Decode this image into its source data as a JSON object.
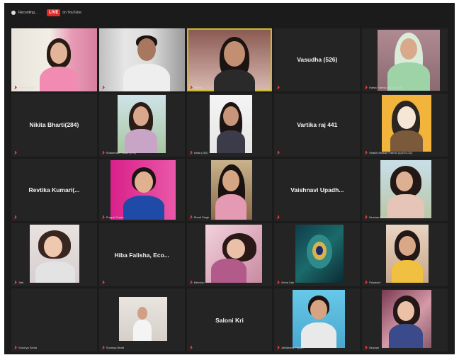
{
  "topbar": {
    "recording_label": "Recording...",
    "live_badge": "LIVE",
    "live_label": "on YouTube"
  },
  "tiles": [
    {
      "label": "Shifa Fatima"
    },
    {
      "label": "Amit Joshi"
    },
    {
      "label": "Nilima"
    },
    {
      "name": "Vasudha (526)",
      "label": ""
    },
    {
      "label": "Hafsa Fatima (Hy-Eco 32)"
    },
    {
      "name": "Nikita Bharti(284)",
      "label": ""
    },
    {
      "label": "Shambhavi Tiwari (174)"
    },
    {
      "label": "Ishita (262)"
    },
    {
      "name": "Vartika raj 441",
      "label": ""
    },
    {
      "label": "Shaikh Misbah Fatima (sy.Eco-32)"
    },
    {
      "name": "Revtika  Kumari(...",
      "label": ""
    },
    {
      "label": "Pragati Gupta"
    },
    {
      "label": "Shruti Singh"
    },
    {
      "name": "Vaishnavi  Upadh...",
      "label": ""
    },
    {
      "label": "Muskan Bharti"
    },
    {
      "label": "Jiah"
    },
    {
      "name": "Hiba Falisha, Eco...",
      "label": ""
    },
    {
      "label": "Mehvish"
    },
    {
      "label": "Neha Sah"
    },
    {
      "label": "Priyakshi"
    },
    {
      "label": "Soumya Sinha"
    },
    {
      "label": "Soumya Bhatt"
    },
    {
      "name": "Saloni Kri",
      "label": ""
    },
    {
      "label": "Abhilasha Priyam"
    },
    {
      "label": "Muskan"
    }
  ]
}
